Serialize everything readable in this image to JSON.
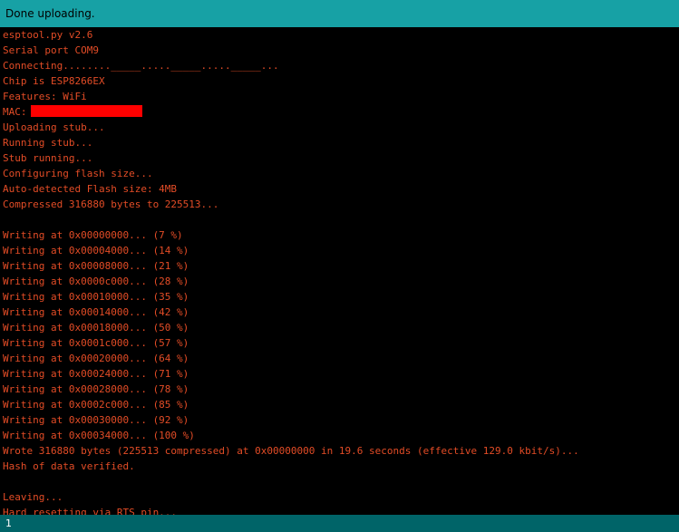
{
  "status": {
    "message": "Done uploading."
  },
  "console": {
    "lines": [
      "esptool.py v2.6",
      "Serial port COM9",
      "Connecting........_____....._____....._____...",
      "Chip is ESP8266EX",
      "Features: WiFi",
      "MAC:",
      "Uploading stub...",
      "Running stub...",
      "Stub running...",
      "Configuring flash size...",
      "Auto-detected Flash size: 4MB",
      "Compressed 316880 bytes to 225513...",
      "",
      "Writing at 0x00000000... (7 %)",
      "Writing at 0x00004000... (14 %)",
      "Writing at 0x00008000... (21 %)",
      "Writing at 0x0000c000... (28 %)",
      "Writing at 0x00010000... (35 %)",
      "Writing at 0x00014000... (42 %)",
      "Writing at 0x00018000... (50 %)",
      "Writing at 0x0001c000... (57 %)",
      "Writing at 0x00020000... (64 %)",
      "Writing at 0x00024000... (71 %)",
      "Writing at 0x00028000... (78 %)",
      "Writing at 0x0002c000... (85 %)",
      "Writing at 0x00030000... (92 %)",
      "Writing at 0x00034000... (100 %)",
      "Wrote 316880 bytes (225513 compressed) at 0x00000000 in 19.6 seconds (effective 129.0 kbit/s)...",
      "Hash of data verified.",
      "",
      "Leaving...",
      "Hard resetting via RTS pin..."
    ],
    "redacted_line_index": 5,
    "text_color": "#e34c26",
    "redaction_color": "#ff0000"
  },
  "footer": {
    "line_number": "1"
  },
  "colors": {
    "status_bar": "#17a1a5",
    "footer_bar": "#006468",
    "console_bg": "#000000"
  }
}
